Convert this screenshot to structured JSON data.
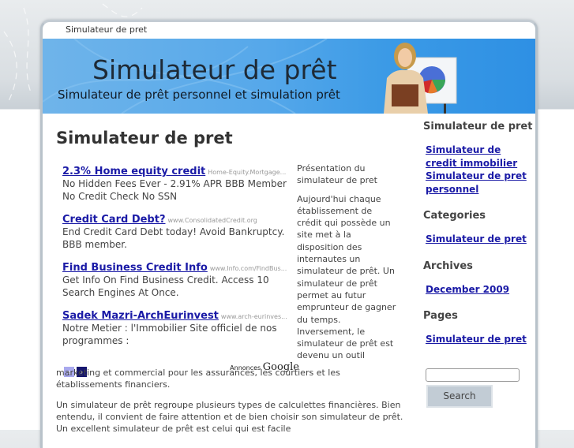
{
  "topbar": {
    "site_name": "Simulateur de pret"
  },
  "banner": {
    "title": "Simulateur de prêt",
    "subtitle": "Simulateur de prêt personnel et simulation prêt",
    "colors": {
      "banner_start": "#6fb4ea",
      "banner_end": "#2e90e4"
    }
  },
  "post": {
    "title": "Simulateur de pret",
    "side_paragraphs": [
      "Présentation du simulateur de pret",
      "Aujourd'hui chaque établissement de crédit qui possède un site met à la disposition des internautes un simulateur de prêt. Un simulateur de prêt permet au futur emprunteur de gagner du temps. Inversement, le simulateur de prêt est devenu un outil"
    ],
    "full_paragraphs": [
      "marketing et commercial pour les assurances, les courtiers et les établissements financiers.",
      "Un simulateur de prêt regroupe plusieurs types de calculettes financières. Bien entendu, il convient de faire attention et de bien choisir son simulateur de prêt. Un excellent simulateur de prêt est celui qui est facile"
    ]
  },
  "ads": {
    "items": [
      {
        "title": "2.3% Home equity credit",
        "url": "Home-Equity.Mortgage...",
        "desc": "No Hidden Fees Ever - 2.91% APR BBB Member No Credit Check No SSN"
      },
      {
        "title": "Credit Card Debt?",
        "url": "www.ConsolidatedCredit.org",
        "desc": "End Credit Card Debt today! Avoid Bankruptcy. BBB member."
      },
      {
        "title": "Find Business Credit Info",
        "url": "www.Info.com/FindBus...",
        "desc": "Get Info On Find Business Credit. Access 10 Search Engines At Once."
      },
      {
        "title": "Sadek Mazri-ArchEurinvest",
        "url": "www.arch-eurinves...",
        "desc": "Notre Metier : l'Immobilier Site officiel de nos programmes :"
      }
    ],
    "prev_icon": "‹",
    "next_icon": "›",
    "label_prefix": "Annonces",
    "label_brand": "Google"
  },
  "sidebar": {
    "sections": [
      {
        "heading": "Simulateur de pret",
        "links": [
          "Simulateur de credit immobilier",
          "Simulateur de pret personnel"
        ]
      },
      {
        "heading": "Categories",
        "links": [
          "Simulateur de pret"
        ]
      },
      {
        "heading": "Archives",
        "links": [
          "December 2009"
        ]
      },
      {
        "heading": "Pages",
        "links": [
          "Simulateur de pret"
        ]
      }
    ],
    "search": {
      "value": "",
      "placeholder": "",
      "button_label": "Search"
    }
  }
}
